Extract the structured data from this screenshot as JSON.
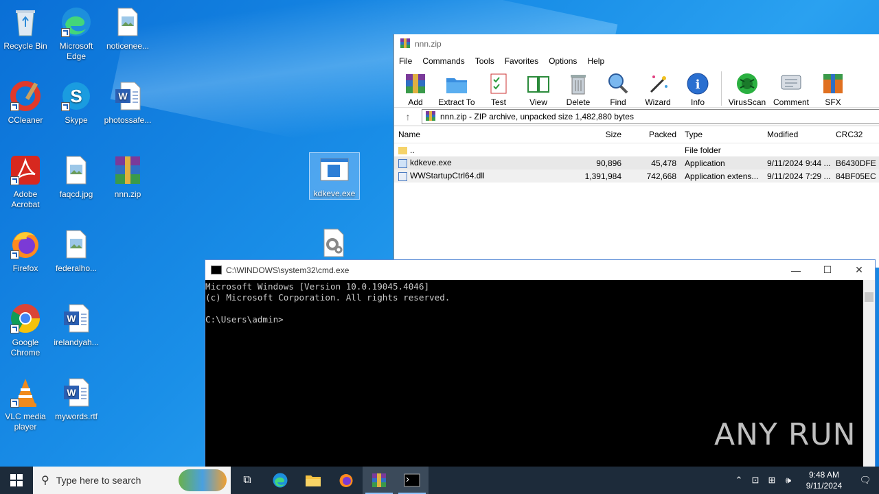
{
  "desktop": {
    "icons": [
      {
        "label": "Recycle Bin"
      },
      {
        "label": "Microsoft Edge"
      },
      {
        "label": "noticenee..."
      },
      {
        "label": "CCleaner"
      },
      {
        "label": "Skype"
      },
      {
        "label": "photossafe..."
      },
      {
        "label": "Adobe Acrobat"
      },
      {
        "label": "faqcd.jpg"
      },
      {
        "label": "nnn.zip"
      },
      {
        "label": "kdkeve.exe"
      },
      {
        "label": "Firefox"
      },
      {
        "label": "federalho..."
      },
      {
        "label": "Google Chrome"
      },
      {
        "label": "irelandyah..."
      },
      {
        "label": "VLC media player"
      },
      {
        "label": "mywords.rtf"
      }
    ]
  },
  "winrar": {
    "title": "nnn.zip",
    "menu": [
      "File",
      "Commands",
      "Tools",
      "Favorites",
      "Options",
      "Help"
    ],
    "toolbar": [
      "Add",
      "Extract To",
      "Test",
      "View",
      "Delete",
      "Find",
      "Wizard",
      "Info",
      "VirusScan",
      "Comment",
      "SFX"
    ],
    "path": "nnn.zip - ZIP archive, unpacked size 1,482,880 bytes",
    "columns": {
      "name": "Name",
      "size": "Size",
      "packed": "Packed",
      "type": "Type",
      "modified": "Modified",
      "crc": "CRC32"
    },
    "rows": [
      {
        "name": "..",
        "size": "",
        "packed": "",
        "type": "File folder",
        "modified": "",
        "crc": ""
      },
      {
        "name": "kdkeve.exe",
        "size": "90,896",
        "packed": "45,478",
        "type": "Application",
        "modified": "9/11/2024 9:44 ...",
        "crc": "B6430DFE"
      },
      {
        "name": "WWStartupCtrl64.dll",
        "size": "1,391,984",
        "packed": "742,668",
        "type": "Application extens...",
        "modified": "9/11/2024 7:29 ...",
        "crc": "84BF05EC"
      }
    ]
  },
  "cmd": {
    "title": "C:\\WINDOWS\\system32\\cmd.exe",
    "lines": [
      "Microsoft Windows [Version 10.0.19045.4046]",
      "(c) Microsoft Corporation. All rights reserved.",
      "",
      "C:\\Users\\admin>"
    ]
  },
  "watermark": "ANY RUN",
  "taskbar": {
    "search_placeholder": "Type here to search",
    "time": "9:48 AM",
    "date": "9/11/2024"
  }
}
